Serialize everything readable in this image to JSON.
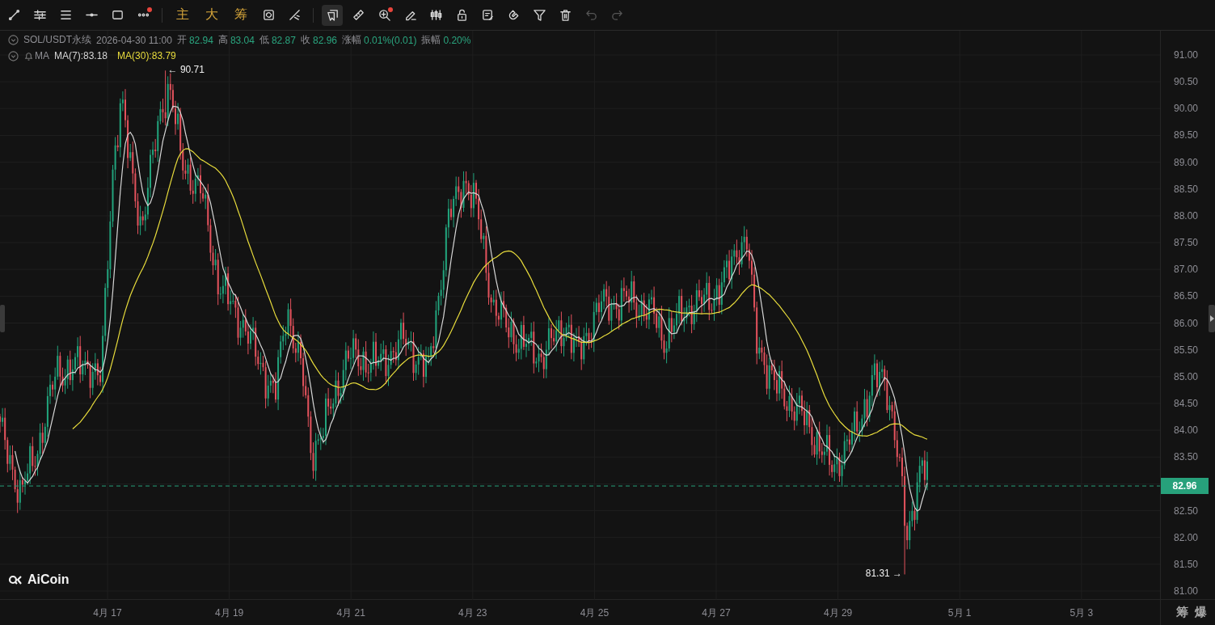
{
  "toolbar": {
    "groups": [
      {
        "items": [
          {
            "kind": "icon",
            "selected": false,
            "disabled": false,
            "badge": false
          },
          {
            "kind": "icon",
            "selected": false,
            "disabled": false,
            "badge": false
          },
          {
            "kind": "icon",
            "selected": false,
            "disabled": false,
            "badge": false
          },
          {
            "kind": "icon",
            "selected": false,
            "disabled": false,
            "badge": false
          },
          {
            "kind": "icon",
            "selected": false,
            "disabled": false,
            "badge": false
          },
          {
            "kind": "icon",
            "selected": false,
            "disabled": false,
            "badge": true
          }
        ]
      },
      {
        "items": [
          {
            "kind": "text",
            "label": "主"
          },
          {
            "kind": "text",
            "label": "大"
          },
          {
            "kind": "text",
            "label": "筹"
          },
          {
            "kind": "icon",
            "selected": false,
            "disabled": false,
            "badge": false
          },
          {
            "kind": "icon",
            "selected": false,
            "disabled": false,
            "badge": false
          }
        ]
      },
      {
        "items": [
          {
            "kind": "icon",
            "selected": true,
            "disabled": false,
            "badge": false
          },
          {
            "kind": "icon",
            "selected": false,
            "disabled": false,
            "badge": false
          },
          {
            "kind": "icon",
            "selected": false,
            "disabled": false,
            "badge": true
          },
          {
            "kind": "icon",
            "selected": false,
            "disabled": false,
            "badge": false
          },
          {
            "kind": "icon",
            "selected": false,
            "disabled": false,
            "badge": false
          },
          {
            "kind": "icon",
            "selected": false,
            "disabled": false,
            "badge": false
          },
          {
            "kind": "icon",
            "selected": false,
            "disabled": false,
            "badge": false
          },
          {
            "kind": "icon",
            "selected": false,
            "disabled": false,
            "badge": false
          },
          {
            "kind": "icon",
            "selected": false,
            "disabled": false,
            "badge": false
          },
          {
            "kind": "icon",
            "selected": false,
            "disabled": false,
            "badge": false
          },
          {
            "kind": "icon",
            "selected": false,
            "disabled": true,
            "badge": false
          },
          {
            "kind": "icon",
            "selected": false,
            "disabled": true,
            "badge": false
          }
        ]
      }
    ]
  },
  "legend": {
    "symbol": "SOL/USDT永续",
    "datetime": "2026-04-30 11:00",
    "fields": [
      {
        "label": "开",
        "value": "82.94"
      },
      {
        "label": "高",
        "value": "83.04"
      },
      {
        "label": "低",
        "value": "82.87"
      },
      {
        "label": "收",
        "value": "82.96"
      },
      {
        "label": "涨幅",
        "value": "0.01%(0.01)"
      },
      {
        "label": "振幅",
        "value": "0.20%"
      }
    ],
    "indicator": "MA",
    "lines": [
      {
        "label": "MA(7):83.18",
        "color": "#d6d6d6"
      },
      {
        "label": "MA(30):83.79",
        "color": "#e8dc3c"
      }
    ]
  },
  "chart": {
    "high_marker": "← 90.71",
    "low_marker": "81.31 →",
    "logo": "AiCoin",
    "current_price": "82.96",
    "price_axis": [
      "91.00",
      "90.50",
      "90.00",
      "89.50",
      "89.00",
      "88.50",
      "88.00",
      "87.50",
      "87.00",
      "86.50",
      "86.00",
      "85.50",
      "85.00",
      "84.50",
      "84.00",
      "83.50",
      "82.50",
      "82.00",
      "81.50",
      "81.00"
    ],
    "date_axis": [
      "4月 17",
      "4月 19",
      "4月 21",
      "4月 23",
      "4月 25",
      "4月 27",
      "4月 29",
      "5月 1",
      "5月 3"
    ]
  },
  "corner": [
    "筹",
    "爆"
  ]
}
